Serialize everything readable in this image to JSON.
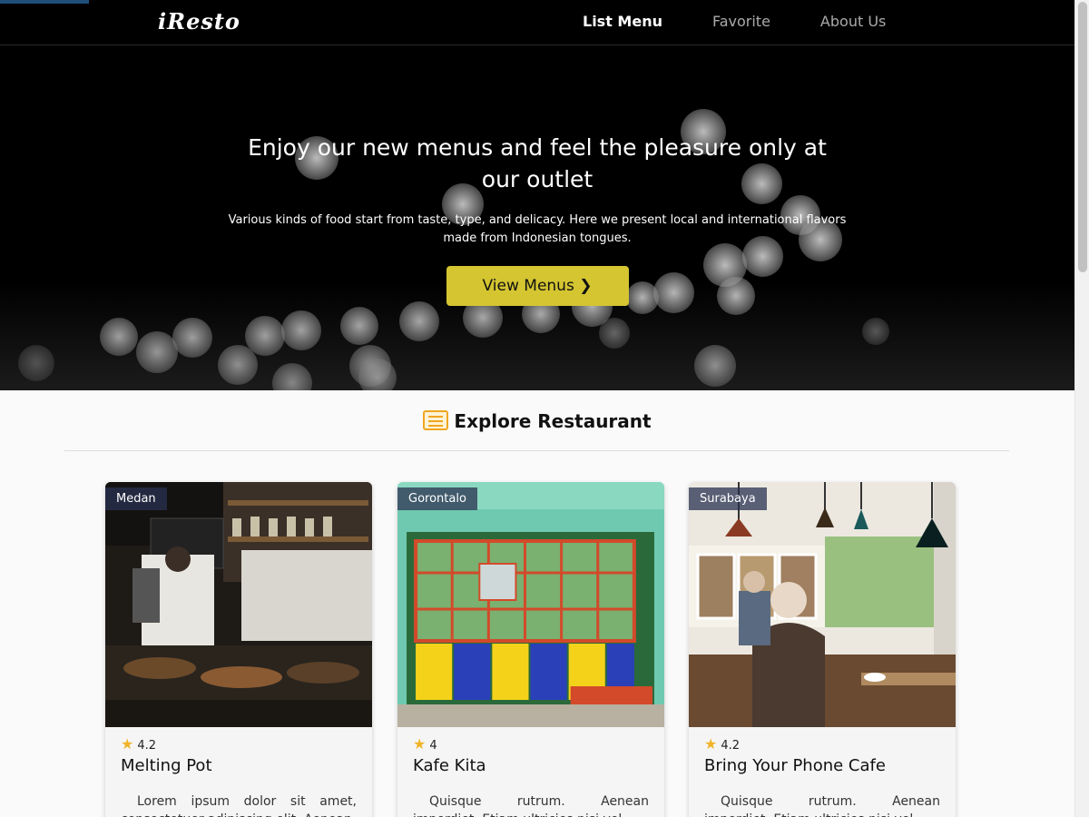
{
  "nav": {
    "brand": "iResto",
    "links": [
      {
        "label": "List Menu",
        "active": true
      },
      {
        "label": "Favorite",
        "active": false
      },
      {
        "label": "About Us",
        "active": false
      }
    ]
  },
  "hero": {
    "title": "Enjoy our new menus and feel the pleasure only at our outlet",
    "subtitle": "Various kinds of food start from taste, type, and delicacy. Here we present local and international flavors made from Indonesian tongues.",
    "button_label": "View Menus ❯"
  },
  "section": {
    "icon": "list-icon",
    "title": "Explore Restaurant"
  },
  "restaurants": [
    {
      "city": "Medan",
      "rating": "4.2",
      "name": "Melting Pot",
      "description": "Lorem ipsum dolor sit amet, consectetuer adipiscing elit. Aenean"
    },
    {
      "city": "Gorontalo",
      "rating": "4",
      "name": "Kafe Kita",
      "description": "Quisque rutrum. Aenean imperdiet. Etiam ultricies nisi vel"
    },
    {
      "city": "Surabaya",
      "rating": "4.2",
      "name": "Bring Your Phone Cafe",
      "description": "Quisque rutrum. Aenean imperdiet. Etiam ultricies nisi vel"
    }
  ],
  "colors": {
    "nav_bg": "#000000",
    "hero_button": "#d4c531",
    "section_icon": "#f0a61f",
    "city_badge": "#283250"
  }
}
